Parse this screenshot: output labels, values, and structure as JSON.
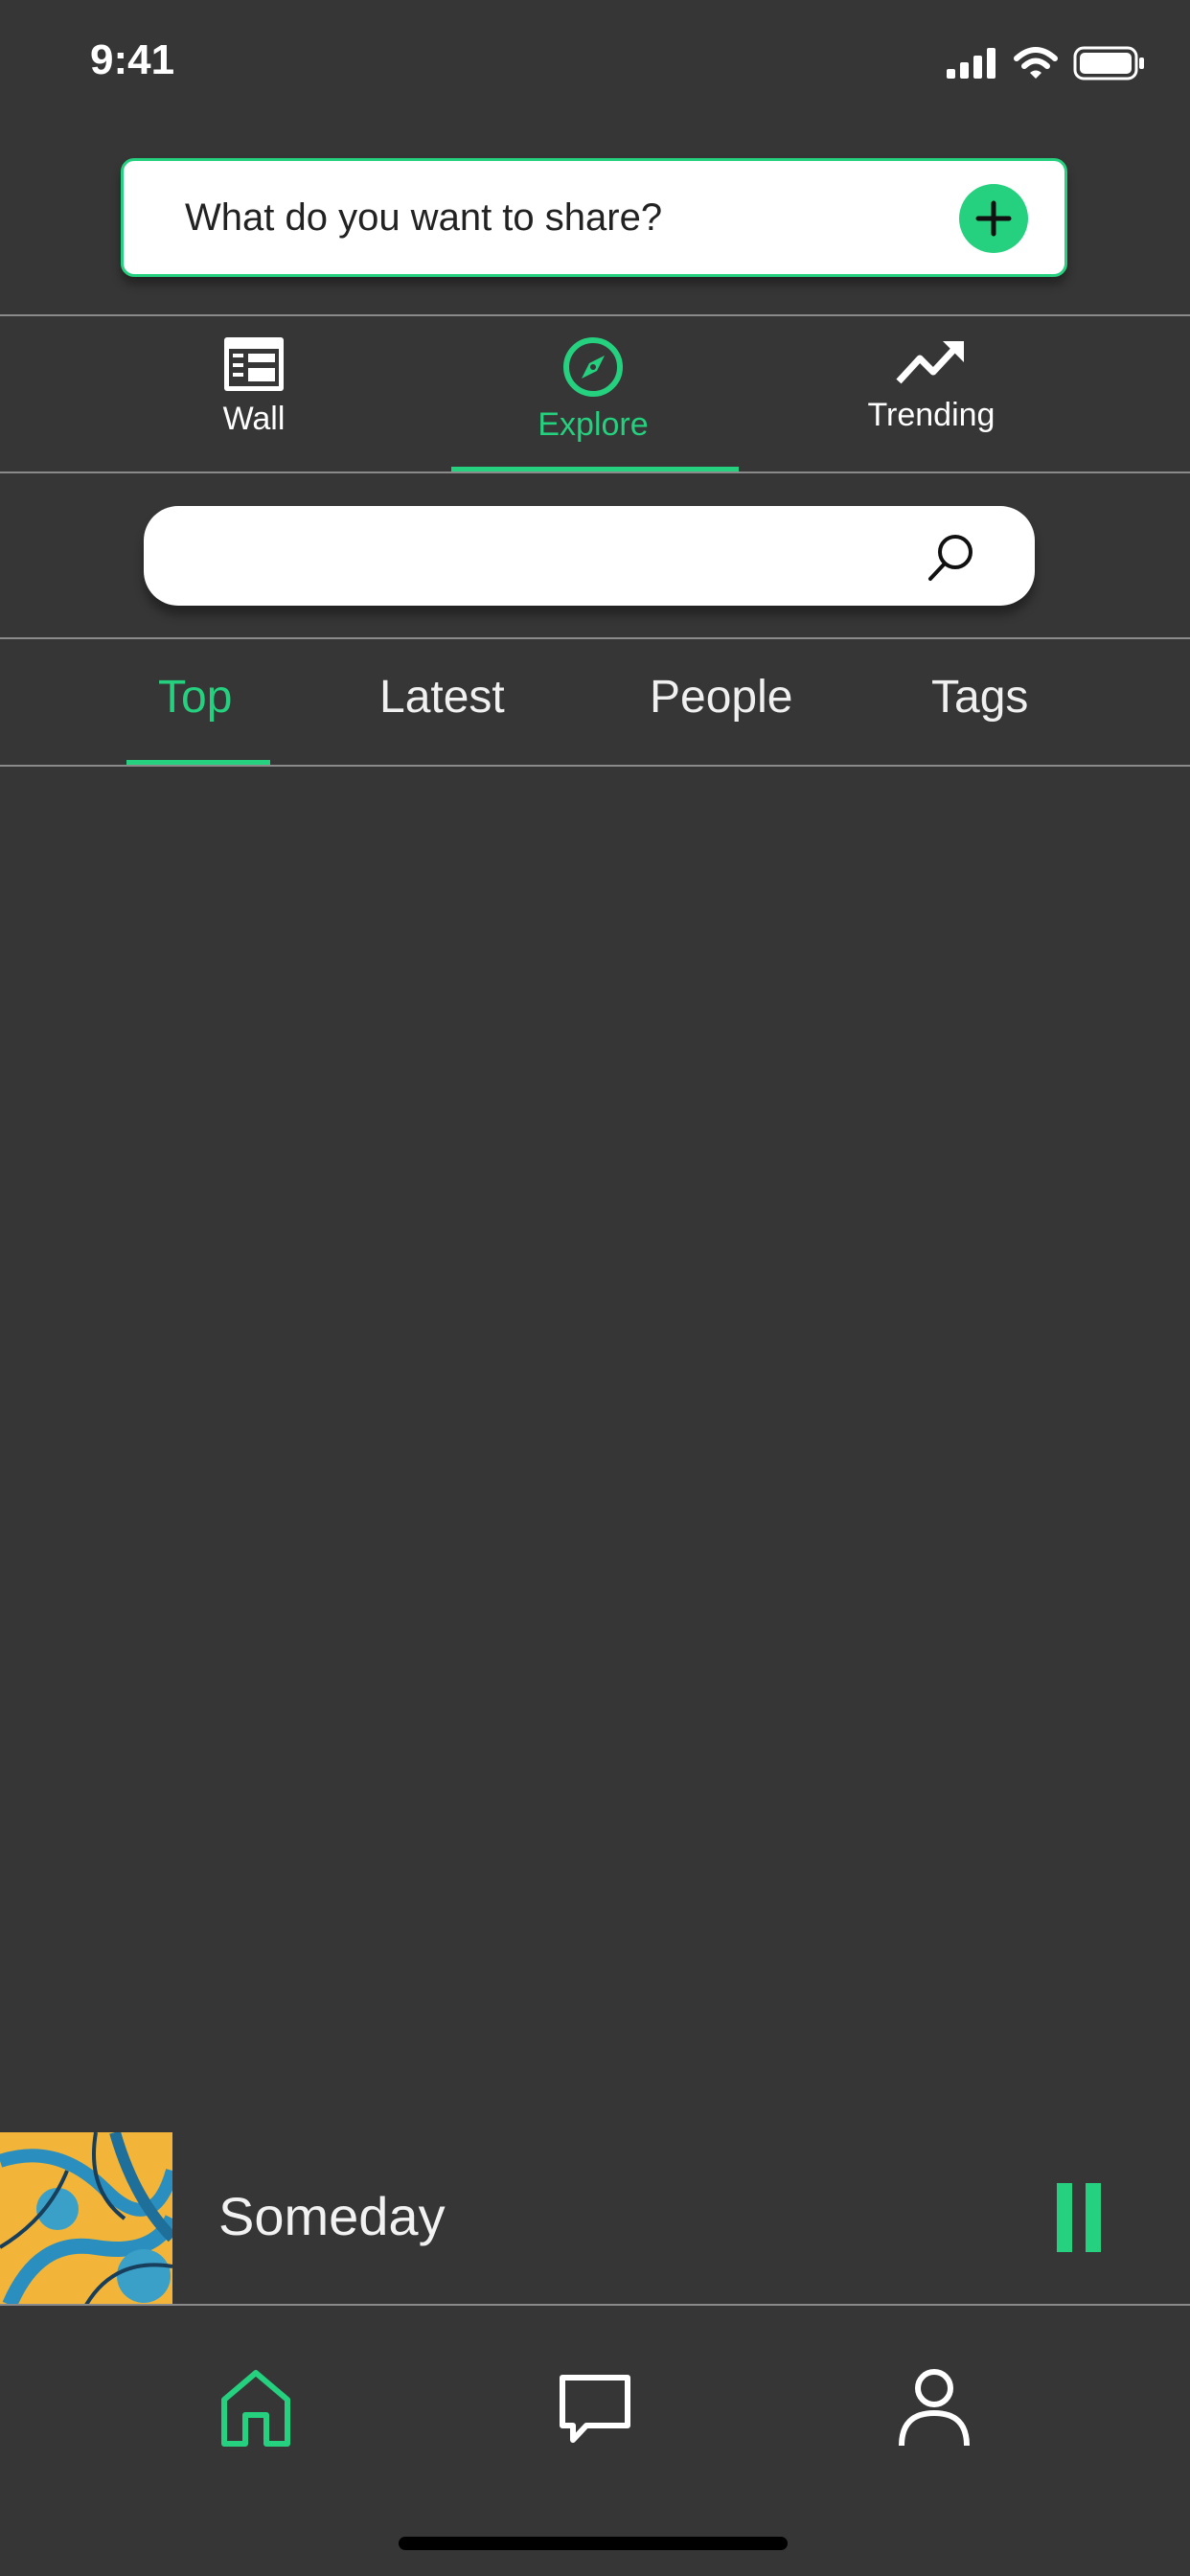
{
  "status_bar": {
    "time": "9:41"
  },
  "composer": {
    "placeholder": "What do you want to share?"
  },
  "top_nav": [
    {
      "label": "Wall",
      "icon": "wall-icon",
      "active": false
    },
    {
      "label": "Explore",
      "icon": "compass-icon",
      "active": true
    },
    {
      "label": "Trending",
      "icon": "trending-icon",
      "active": false
    }
  ],
  "search": {
    "placeholder": ""
  },
  "sub_tabs": [
    {
      "label": "Top",
      "active": true
    },
    {
      "label": "Latest",
      "active": false
    },
    {
      "label": "People",
      "active": false
    },
    {
      "label": "Tags",
      "active": false
    }
  ],
  "now_playing": {
    "title": "Someday",
    "state": "playing"
  },
  "bottom_nav": [
    {
      "icon": "home-icon",
      "active": true
    },
    {
      "icon": "chat-icon",
      "active": false
    },
    {
      "icon": "profile-icon",
      "active": false
    }
  ],
  "colors": {
    "accent": "#25d07f",
    "background": "#363636",
    "text": "#ffffff"
  }
}
